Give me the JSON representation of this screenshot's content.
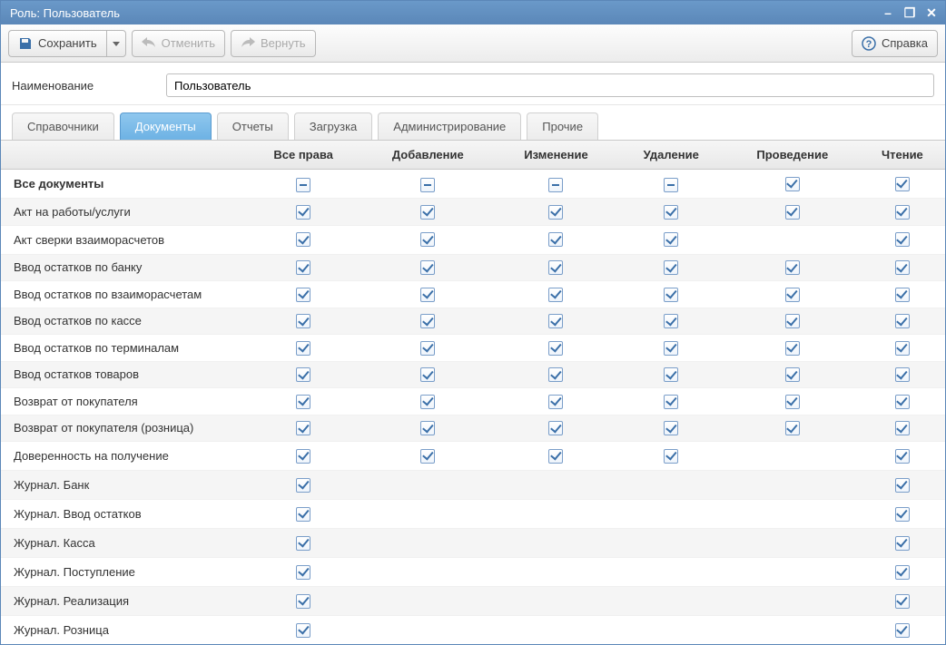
{
  "window": {
    "title": "Роль: Пользователь"
  },
  "toolbar": {
    "save": "Сохранить",
    "undo": "Отменить",
    "redo": "Вернуть",
    "help": "Справка"
  },
  "form": {
    "name_label": "Наименование",
    "name_value": "Пользователь"
  },
  "tabs": [
    {
      "label": "Справочники",
      "active": false
    },
    {
      "label": "Документы",
      "active": true
    },
    {
      "label": "Отчеты",
      "active": false
    },
    {
      "label": "Загрузка",
      "active": false
    },
    {
      "label": "Администрирование",
      "active": false
    },
    {
      "label": "Прочие",
      "active": false
    }
  ],
  "columns": [
    "",
    "Все права",
    "Добавление",
    "Изменение",
    "Удаление",
    "Проведение",
    "Чтение"
  ],
  "rows": [
    {
      "label": "Все документы",
      "bold": true,
      "cells": [
        "indet",
        "indet",
        "indet",
        "indet",
        "checked",
        "checked"
      ]
    },
    {
      "label": "Акт на работы/услуги",
      "cells": [
        "checked",
        "checked",
        "checked",
        "checked",
        "checked",
        "checked"
      ]
    },
    {
      "label": "Акт сверки взаиморасчетов",
      "cells": [
        "checked",
        "checked",
        "checked",
        "checked",
        "",
        "checked"
      ]
    },
    {
      "label": "Ввод остатков по банку",
      "cells": [
        "checked",
        "checked",
        "checked",
        "checked",
        "checked",
        "checked"
      ]
    },
    {
      "label": "Ввод остатков по взаиморасчетам",
      "cells": [
        "checked",
        "checked",
        "checked",
        "checked",
        "checked",
        "checked"
      ]
    },
    {
      "label": "Ввод остатков по кассе",
      "cells": [
        "checked",
        "checked",
        "checked",
        "checked",
        "checked",
        "checked"
      ]
    },
    {
      "label": "Ввод остатков по терминалам",
      "cells": [
        "checked",
        "checked",
        "checked",
        "checked",
        "checked",
        "checked"
      ]
    },
    {
      "label": "Ввод остатков товаров",
      "cells": [
        "checked",
        "checked",
        "checked",
        "checked",
        "checked",
        "checked"
      ]
    },
    {
      "label": "Возврат от покупателя",
      "cells": [
        "checked",
        "checked",
        "checked",
        "checked",
        "checked",
        "checked"
      ]
    },
    {
      "label": "Возврат от покупателя (розница)",
      "cells": [
        "checked",
        "checked",
        "checked",
        "checked",
        "checked",
        "checked"
      ]
    },
    {
      "label": "Доверенность на получение",
      "cells": [
        "checked",
        "checked",
        "checked",
        "checked",
        "",
        "checked"
      ]
    },
    {
      "label": "Журнал. Банк",
      "cells": [
        "checked",
        "",
        "",
        "",
        "",
        "checked"
      ]
    },
    {
      "label": "Журнал. Ввод остатков",
      "cells": [
        "checked",
        "",
        "",
        "",
        "",
        "checked"
      ]
    },
    {
      "label": "Журнал. Касса",
      "cells": [
        "checked",
        "",
        "",
        "",
        "",
        "checked"
      ]
    },
    {
      "label": "Журнал. Поступление",
      "cells": [
        "checked",
        "",
        "",
        "",
        "",
        "checked"
      ]
    },
    {
      "label": "Журнал. Реализация",
      "cells": [
        "checked",
        "",
        "",
        "",
        "",
        "checked"
      ]
    },
    {
      "label": "Журнал. Розница",
      "cells": [
        "checked",
        "",
        "",
        "",
        "",
        "checked"
      ]
    }
  ]
}
